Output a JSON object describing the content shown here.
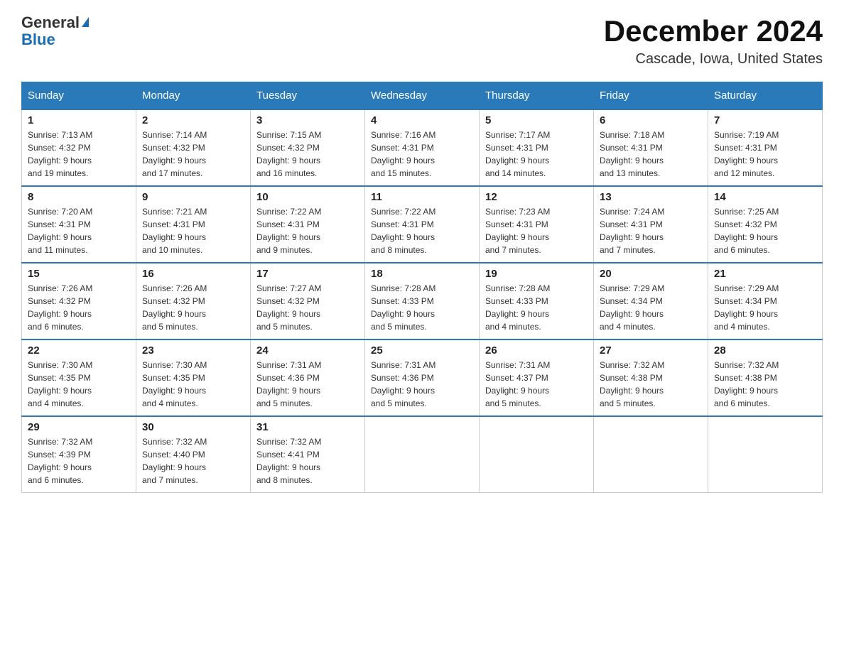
{
  "header": {
    "logo_general": "General",
    "logo_blue": "Blue",
    "title": "December 2024",
    "subtitle": "Cascade, Iowa, United States"
  },
  "weekdays": [
    "Sunday",
    "Monday",
    "Tuesday",
    "Wednesday",
    "Thursday",
    "Friday",
    "Saturday"
  ],
  "weeks": [
    [
      {
        "day": "1",
        "sunrise": "7:13 AM",
        "sunset": "4:32 PM",
        "daylight": "9 hours and 19 minutes."
      },
      {
        "day": "2",
        "sunrise": "7:14 AM",
        "sunset": "4:32 PM",
        "daylight": "9 hours and 17 minutes."
      },
      {
        "day": "3",
        "sunrise": "7:15 AM",
        "sunset": "4:32 PM",
        "daylight": "9 hours and 16 minutes."
      },
      {
        "day": "4",
        "sunrise": "7:16 AM",
        "sunset": "4:31 PM",
        "daylight": "9 hours and 15 minutes."
      },
      {
        "day": "5",
        "sunrise": "7:17 AM",
        "sunset": "4:31 PM",
        "daylight": "9 hours and 14 minutes."
      },
      {
        "day": "6",
        "sunrise": "7:18 AM",
        "sunset": "4:31 PM",
        "daylight": "9 hours and 13 minutes."
      },
      {
        "day": "7",
        "sunrise": "7:19 AM",
        "sunset": "4:31 PM",
        "daylight": "9 hours and 12 minutes."
      }
    ],
    [
      {
        "day": "8",
        "sunrise": "7:20 AM",
        "sunset": "4:31 PM",
        "daylight": "9 hours and 11 minutes."
      },
      {
        "day": "9",
        "sunrise": "7:21 AM",
        "sunset": "4:31 PM",
        "daylight": "9 hours and 10 minutes."
      },
      {
        "day": "10",
        "sunrise": "7:22 AM",
        "sunset": "4:31 PM",
        "daylight": "9 hours and 9 minutes."
      },
      {
        "day": "11",
        "sunrise": "7:22 AM",
        "sunset": "4:31 PM",
        "daylight": "9 hours and 8 minutes."
      },
      {
        "day": "12",
        "sunrise": "7:23 AM",
        "sunset": "4:31 PM",
        "daylight": "9 hours and 7 minutes."
      },
      {
        "day": "13",
        "sunrise": "7:24 AM",
        "sunset": "4:31 PM",
        "daylight": "9 hours and 7 minutes."
      },
      {
        "day": "14",
        "sunrise": "7:25 AM",
        "sunset": "4:32 PM",
        "daylight": "9 hours and 6 minutes."
      }
    ],
    [
      {
        "day": "15",
        "sunrise": "7:26 AM",
        "sunset": "4:32 PM",
        "daylight": "9 hours and 6 minutes."
      },
      {
        "day": "16",
        "sunrise": "7:26 AM",
        "sunset": "4:32 PM",
        "daylight": "9 hours and 5 minutes."
      },
      {
        "day": "17",
        "sunrise": "7:27 AM",
        "sunset": "4:32 PM",
        "daylight": "9 hours and 5 minutes."
      },
      {
        "day": "18",
        "sunrise": "7:28 AM",
        "sunset": "4:33 PM",
        "daylight": "9 hours and 5 minutes."
      },
      {
        "day": "19",
        "sunrise": "7:28 AM",
        "sunset": "4:33 PM",
        "daylight": "9 hours and 4 minutes."
      },
      {
        "day": "20",
        "sunrise": "7:29 AM",
        "sunset": "4:34 PM",
        "daylight": "9 hours and 4 minutes."
      },
      {
        "day": "21",
        "sunrise": "7:29 AM",
        "sunset": "4:34 PM",
        "daylight": "9 hours and 4 minutes."
      }
    ],
    [
      {
        "day": "22",
        "sunrise": "7:30 AM",
        "sunset": "4:35 PM",
        "daylight": "9 hours and 4 minutes."
      },
      {
        "day": "23",
        "sunrise": "7:30 AM",
        "sunset": "4:35 PM",
        "daylight": "9 hours and 4 minutes."
      },
      {
        "day": "24",
        "sunrise": "7:31 AM",
        "sunset": "4:36 PM",
        "daylight": "9 hours and 5 minutes."
      },
      {
        "day": "25",
        "sunrise": "7:31 AM",
        "sunset": "4:36 PM",
        "daylight": "9 hours and 5 minutes."
      },
      {
        "day": "26",
        "sunrise": "7:31 AM",
        "sunset": "4:37 PM",
        "daylight": "9 hours and 5 minutes."
      },
      {
        "day": "27",
        "sunrise": "7:32 AM",
        "sunset": "4:38 PM",
        "daylight": "9 hours and 5 minutes."
      },
      {
        "day": "28",
        "sunrise": "7:32 AM",
        "sunset": "4:38 PM",
        "daylight": "9 hours and 6 minutes."
      }
    ],
    [
      {
        "day": "29",
        "sunrise": "7:32 AM",
        "sunset": "4:39 PM",
        "daylight": "9 hours and 6 minutes."
      },
      {
        "day": "30",
        "sunrise": "7:32 AM",
        "sunset": "4:40 PM",
        "daylight": "9 hours and 7 minutes."
      },
      {
        "day": "31",
        "sunrise": "7:32 AM",
        "sunset": "4:41 PM",
        "daylight": "9 hours and 8 minutes."
      },
      null,
      null,
      null,
      null
    ]
  ],
  "labels": {
    "sunrise_prefix": "Sunrise: ",
    "sunset_prefix": "Sunset: ",
    "daylight_prefix": "Daylight: "
  }
}
